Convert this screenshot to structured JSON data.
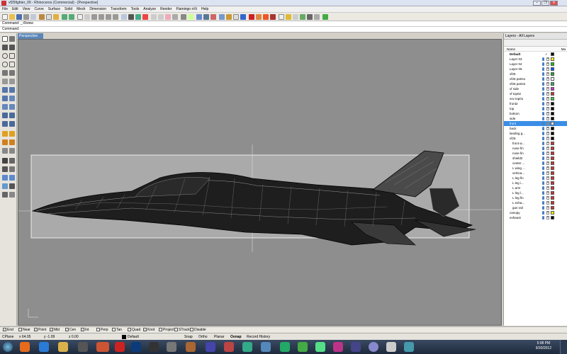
{
  "window": {
    "title": "vf25fighter_09 - Rhinoceros (Commercial) - [Perspective]",
    "buttons": [
      "–",
      "❐",
      "✕"
    ]
  },
  "menu": [
    "File",
    "Edit",
    "View",
    "Curve",
    "Surface",
    "Solid",
    "Mesh",
    "Dimension",
    "Transform",
    "Tools",
    "Analyze",
    "Render",
    "Flamingo nXt",
    "Help"
  ],
  "command": {
    "history": "Command: _-Rview",
    "prompt": "Command:"
  },
  "viewport": {
    "label": "Perspective"
  },
  "layers": {
    "title": "Layers - All Layers",
    "column_name": "Name",
    "column_extra": "Ma",
    "rows": [
      {
        "name": "Default",
        "check": "✓",
        "color": "#000000",
        "indent": 0,
        "bold": true
      },
      {
        "name": "Layer 03",
        "color": "#ffff00",
        "indent": 0
      },
      {
        "name": "Layer 04",
        "color": "#00cc00",
        "indent": 0
      },
      {
        "name": "Layer 05",
        "color": "#0055ff",
        "indent": 0
      },
      {
        "name": "vf25",
        "color": "#22aa22",
        "indent": 0
      },
      {
        "name": "vf25 parts1",
        "color": "#ffffff",
        "indent": 0
      },
      {
        "name": "vf25 parts2",
        "color": "#33aa66",
        "indent": 0
      },
      {
        "name": "vf side",
        "color": "#cc33cc",
        "indent": 0
      },
      {
        "name": "vf top02",
        "color": "#cc3333",
        "indent": 0
      },
      {
        "name": "vvv top01",
        "color": "#33cc33",
        "indent": 0
      },
      {
        "name": "front2",
        "color": "#000000",
        "indent": 0
      },
      {
        "name": "top",
        "color": "#000000",
        "indent": 0
      },
      {
        "name": "bottom",
        "color": "#000000",
        "indent": 0
      },
      {
        "name": "side",
        "color": "#000000",
        "indent": 0
      },
      {
        "name": "front",
        "color": "#ffffff",
        "indent": 0,
        "selected": true
      },
      {
        "name": "back",
        "color": "#000000",
        "indent": 0
      },
      {
        "name": "landing g...",
        "color": "#000000",
        "indent": 0
      },
      {
        "name": "vf25",
        "color": "#000000",
        "indent": 0
      },
      {
        "name": "front w...",
        "color": "#cc3333",
        "indent": 1
      },
      {
        "name": "nose fin",
        "color": "#cc3333",
        "indent": 1
      },
      {
        "name": "nose fin",
        "color": "#cc3333",
        "indent": 1
      },
      {
        "name": "shield2",
        "color": "#cc3333",
        "indent": 1
      },
      {
        "name": "center ...",
        "color": "#cc3333",
        "indent": 1
      },
      {
        "name": "L wing ...",
        "color": "#cc3333",
        "indent": 1
      },
      {
        "name": "vertica...",
        "color": "#cc3333",
        "indent": 1
      },
      {
        "name": "L leg fin",
        "color": "#cc3333",
        "indent": 1
      },
      {
        "name": "L leg i...",
        "color": "#cc3333",
        "indent": 1
      },
      {
        "name": "L arm",
        "color": "#cc3333",
        "indent": 1
      },
      {
        "name": "L leg l...",
        "color": "#cc3333",
        "indent": 1
      },
      {
        "name": "L leg fin",
        "color": "#cc3333",
        "indent": 1
      },
      {
        "name": "L exha...",
        "color": "#cc3333",
        "indent": 1
      },
      {
        "name": "gun rail",
        "color": "#cc3333",
        "indent": 1
      },
      {
        "name": "canopy",
        "color": "#ffff00",
        "indent": 0
      },
      {
        "name": "exhaust",
        "color": "#000000",
        "indent": 0
      }
    ]
  },
  "osnap": [
    {
      "label": "End",
      "checked": true
    },
    {
      "label": "Near",
      "checked": false
    },
    {
      "label": "Point",
      "checked": true
    },
    {
      "label": "Mid",
      "checked": true
    },
    {
      "label": "Cen",
      "checked": true
    },
    {
      "label": "Int",
      "checked": true
    },
    {
      "label": "Perp",
      "checked": false
    },
    {
      "label": "Tan",
      "checked": false
    },
    {
      "label": "Quad",
      "checked": false
    },
    {
      "label": "Knot",
      "checked": true
    },
    {
      "label": "Project",
      "checked": false
    },
    {
      "label": "STrack",
      "checked": false
    },
    {
      "label": "Disable",
      "checked": false
    }
  ],
  "status": {
    "cplane": "CPlane",
    "x": "x 64.05",
    "y": "y -1.09",
    "z": "z 0.00",
    "layer": "Default",
    "toggles": [
      "Snap",
      "Ortho",
      "Planar",
      "Osnap",
      "Record History"
    ]
  },
  "taskbar": {
    "time": "5:08 PM",
    "date": "9/30/2012"
  },
  "colors": {
    "selection": "#3a8ee6",
    "viewport_bg": "#8e8e8e",
    "taskbar": "#1e2a3c"
  }
}
